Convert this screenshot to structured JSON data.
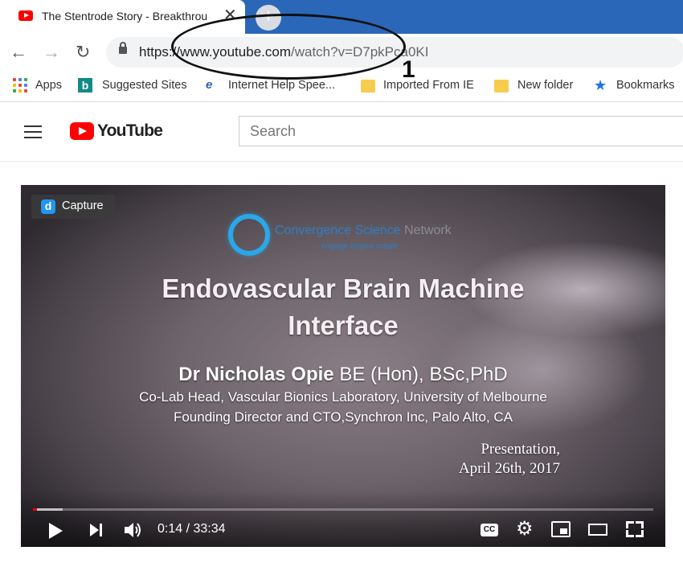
{
  "browser": {
    "tab": {
      "title": "The Stentrode Story - Breakthrou",
      "close": "✕"
    },
    "new_tab": "+",
    "nav": {
      "back": "←",
      "forward": "→",
      "reload": "↻"
    },
    "url": {
      "scheme": "https://",
      "host": "www.youtube.com",
      "path": "/watch?v=D7pkPca0KI"
    },
    "bookmarks": [
      {
        "label": "Apps",
        "icon": "apps-grid-icon"
      },
      {
        "label": "Suggested Sites",
        "icon": "bing-icon"
      },
      {
        "label": "Internet Help Spee...",
        "icon": "ie-icon"
      },
      {
        "label": "Imported From IE",
        "icon": "folder-icon"
      },
      {
        "label": "New folder",
        "icon": "folder-icon"
      },
      {
        "label": "Bookmarks",
        "icon": "star-icon"
      }
    ],
    "apps_colors": [
      "#ea4335",
      "#4285f4",
      "#34a853",
      "#fbbc05",
      "#ea4335",
      "#4285f4",
      "#34a853",
      "#fbbc05",
      "#ea4335"
    ]
  },
  "youtube": {
    "logo_text": "YouTube",
    "search_placeholder": "Search",
    "brand_color": "#ff0000"
  },
  "video": {
    "capture_label": "Capture",
    "slide": {
      "org_name_a": "Convergence Science",
      "org_name_b": " Network",
      "org_tagline": "engage inspire create",
      "title_line1": "Endovascular Brain Machine",
      "title_line2": "Interface",
      "presenter_name": "Dr Nicholas Opie",
      "presenter_creds": " BE (Hon), BSc,PhD",
      "affiliation_1": "Co-Lab Head, Vascular Bionics Laboratory, University of Melbourne",
      "affiliation_2": "Founding Director and CTO,Synchron Inc, Palo Alto, CA",
      "presentation_label": "Presentation,",
      "presentation_date": "April 26th, 2017"
    },
    "player": {
      "time": "0:14 / 33:34",
      "cc_label": "CC",
      "progress_played_fraction": 0.007,
      "progress_buffered_fraction": 0.048
    }
  },
  "annotation": {
    "number": "1"
  }
}
